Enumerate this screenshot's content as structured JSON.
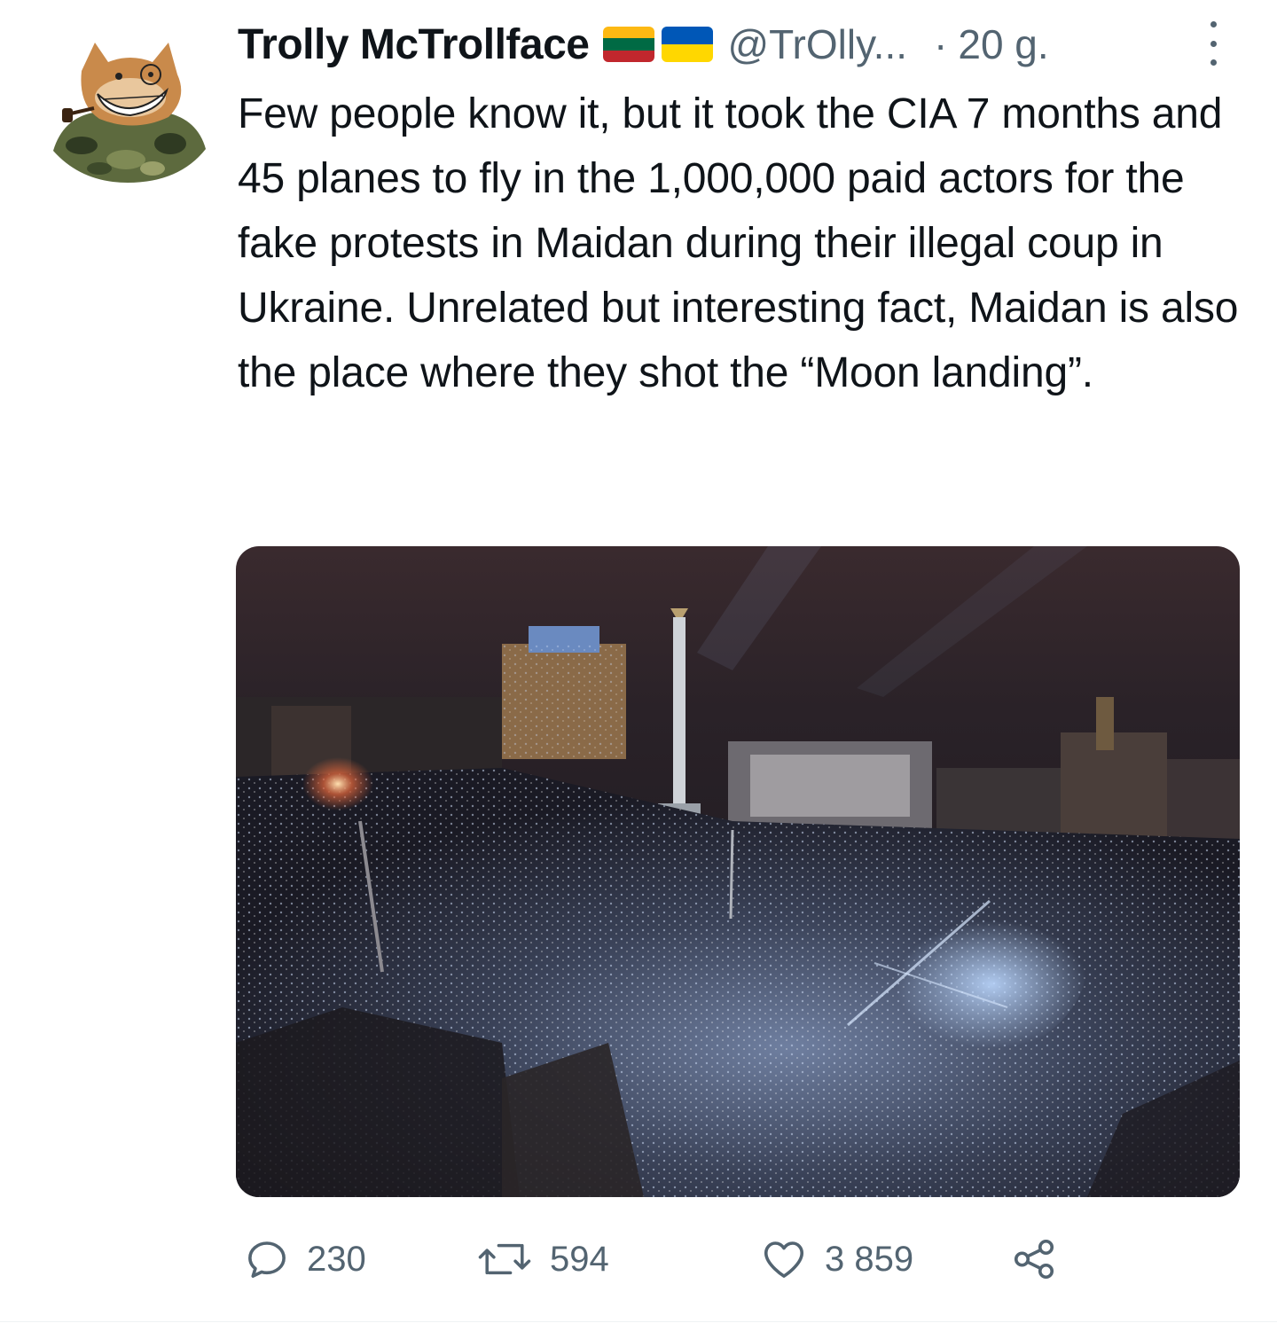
{
  "tweet": {
    "author_name": "Trolly McTrollface",
    "flags": [
      "lithuania-flag",
      "ukraine-flag"
    ],
    "handle": "@TrOlly...",
    "separator": "·",
    "time": "20 g.",
    "text": "Few people know it, but it took the CIA 7 months and 45 planes to fly in the 1,000,000 paid actors for the fake protests in Maidan during their illegal coup in Ukraine. Unrelated but interesting fact, Maidan is also the place where they shot the “Moon landing”."
  },
  "actions": {
    "replies": "230",
    "retweets": "594",
    "likes": "3 859"
  },
  "colors": {
    "text": "#0f1419",
    "secondary": "#536471",
    "lithuania": [
      "#FDB913",
      "#006A44",
      "#C1272D"
    ],
    "ukraine": [
      "#0057B7",
      "#FFD700"
    ]
  },
  "icons": {
    "reply": "reply-icon",
    "retweet": "retweet-icon",
    "like": "heart-icon",
    "share": "share-icon",
    "more": "more-vertical-icon"
  }
}
